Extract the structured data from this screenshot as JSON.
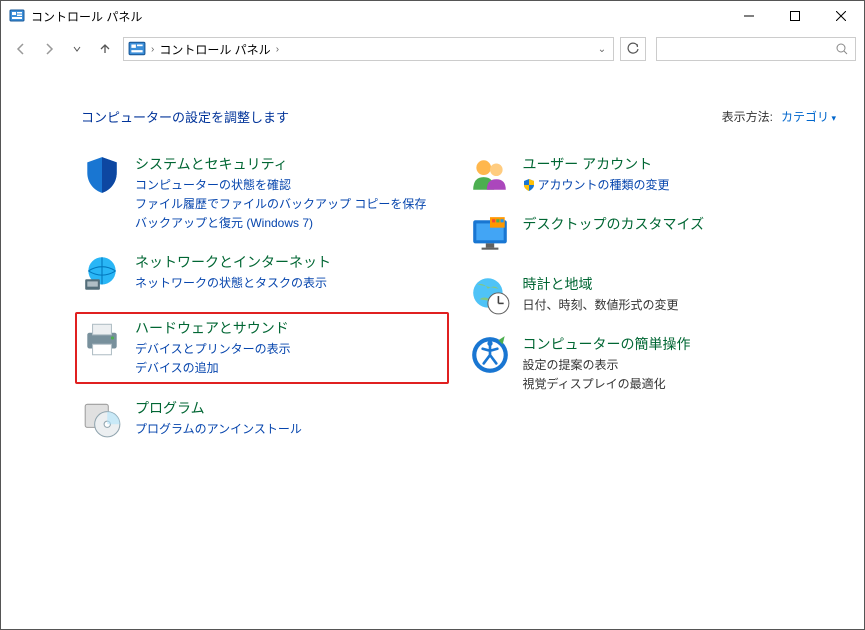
{
  "window": {
    "title": "コントロール パネル"
  },
  "breadcrumb": {
    "item1": "コントロール パネル"
  },
  "search": {
    "placeholder": ""
  },
  "header": {
    "adjust": "コンピューターの設定を調整します",
    "viewby_label": "表示方法:",
    "viewby_value": "カテゴリ"
  },
  "left": [
    {
      "title": "システムとセキュリティ",
      "links": [
        "コンピューターの状態を確認",
        "ファイル履歴でファイルのバックアップ コピーを保存",
        "バックアップと復元 (Windows 7)"
      ],
      "highlighted": false
    },
    {
      "title": "ネットワークとインターネット",
      "links": [
        "ネットワークの状態とタスクの表示"
      ],
      "highlighted": false
    },
    {
      "title": "ハードウェアとサウンド",
      "links": [
        "デバイスとプリンターの表示",
        "デバイスの追加"
      ],
      "highlighted": true
    },
    {
      "title": "プログラム",
      "links": [
        "プログラムのアンインストール"
      ],
      "highlighted": false
    }
  ],
  "right": [
    {
      "title": "ユーザー アカウント",
      "links": [
        "アカウントの種類の変更"
      ],
      "shield": [
        true
      ]
    },
    {
      "title": "デスクトップのカスタマイズ",
      "links": []
    },
    {
      "title": "時計と地域",
      "subs": [
        "日付、時刻、数値形式の変更"
      ]
    },
    {
      "title": "コンピューターの簡単操作",
      "subs": [
        "設定の提案の表示",
        "視覚ディスプレイの最適化"
      ]
    }
  ]
}
